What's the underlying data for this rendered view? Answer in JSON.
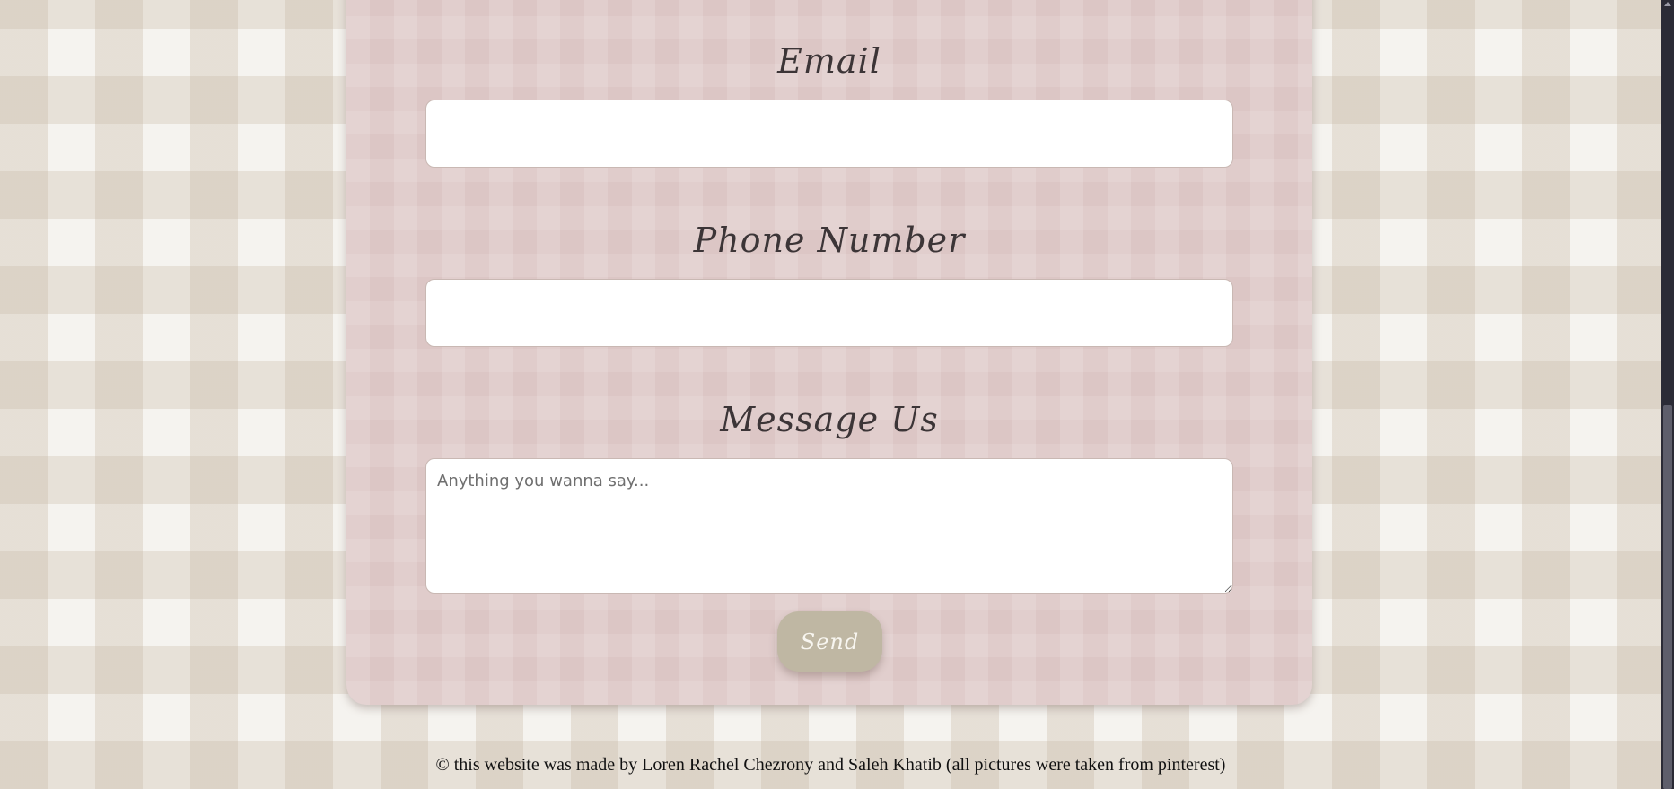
{
  "form": {
    "email_label": "Email",
    "email_value": "",
    "phone_label": "Phone Number",
    "phone_value": "",
    "message_label": "Message Us",
    "message_placeholder": "Anything you wanna say...",
    "send_label": "Send"
  },
  "footer": {
    "text": "© this website was made by Loren Rachel Chezrony and Saleh Khatib (all pictures were taken from pinterest)"
  },
  "colors": {
    "background": "#f5f3ef",
    "card": "#dcc6c5",
    "button": "#bfb7a3",
    "label_text": "#3c3537"
  }
}
